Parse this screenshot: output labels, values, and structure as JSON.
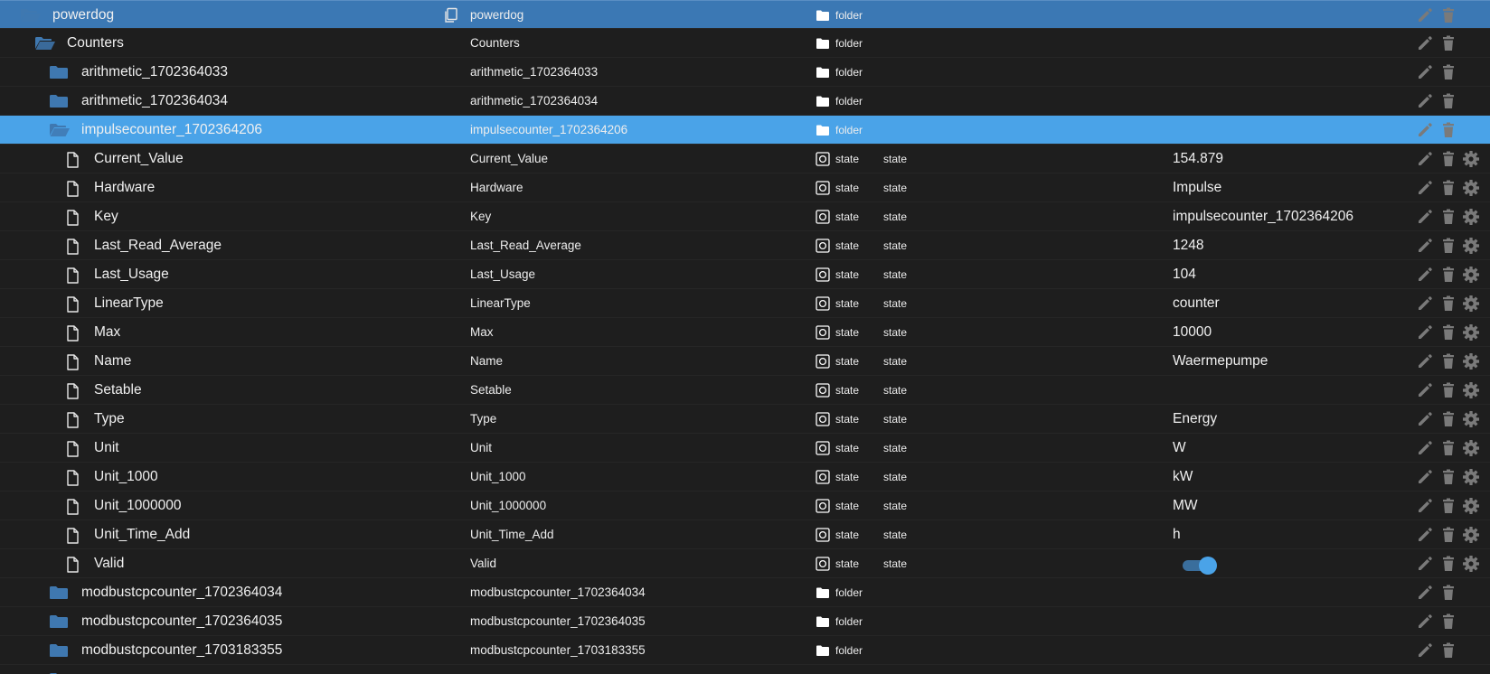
{
  "colors": {
    "background": "#1e1e1e",
    "root_row": "#3b78b4",
    "selected_row": "#4aa3e8",
    "folder_icon": "#3f78b0",
    "action_icon": "#7a7a7a",
    "toggle_on": "#4aa3e8"
  },
  "rows": [
    {
      "name": "powerdog",
      "alias": "powerdog",
      "type": "folder",
      "role": "",
      "value": "",
      "kind": "folder-open",
      "level": 0,
      "root": true,
      "alias_icon": "copy-icon"
    },
    {
      "name": "Counters",
      "alias": "Counters",
      "type": "folder",
      "role": "",
      "value": "",
      "kind": "folder-open",
      "level": 1
    },
    {
      "name": "arithmetic_1702364033",
      "alias": "arithmetic_1702364033",
      "type": "folder",
      "role": "",
      "value": "",
      "kind": "folder",
      "level": 2
    },
    {
      "name": "arithmetic_1702364034",
      "alias": "arithmetic_1702364034",
      "type": "folder",
      "role": "",
      "value": "",
      "kind": "folder",
      "level": 2
    },
    {
      "name": "impulsecounter_1702364206",
      "alias": "impulsecounter_1702364206",
      "type": "folder",
      "role": "",
      "value": "",
      "kind": "folder-open",
      "level": 2,
      "selected": true
    },
    {
      "name": "Current_Value",
      "alias": "Current_Value",
      "type": "state",
      "role": "state",
      "value": "154.879",
      "kind": "file",
      "level": 3
    },
    {
      "name": "Hardware",
      "alias": "Hardware",
      "type": "state",
      "role": "state",
      "value": "Impulse",
      "kind": "file",
      "level": 3
    },
    {
      "name": "Key",
      "alias": "Key",
      "type": "state",
      "role": "state",
      "value": "impulsecounter_1702364206",
      "kind": "file",
      "level": 3
    },
    {
      "name": "Last_Read_Average",
      "alias": "Last_Read_Average",
      "type": "state",
      "role": "state",
      "value": "1248",
      "kind": "file",
      "level": 3
    },
    {
      "name": "Last_Usage",
      "alias": "Last_Usage",
      "type": "state",
      "role": "state",
      "value": "104",
      "kind": "file",
      "level": 3
    },
    {
      "name": "LinearType",
      "alias": "LinearType",
      "type": "state",
      "role": "state",
      "value": "counter",
      "kind": "file",
      "level": 3
    },
    {
      "name": "Max",
      "alias": "Max",
      "type": "state",
      "role": "state",
      "value": "10000",
      "kind": "file",
      "level": 3
    },
    {
      "name": "Name",
      "alias": "Name",
      "type": "state",
      "role": "state",
      "value": "Waermepumpe",
      "kind": "file",
      "level": 3
    },
    {
      "name": "Setable",
      "alias": "Setable",
      "type": "state",
      "role": "state",
      "value": "",
      "kind": "file",
      "level": 3
    },
    {
      "name": "Type",
      "alias": "Type",
      "type": "state",
      "role": "state",
      "value": "Energy",
      "kind": "file",
      "level": 3
    },
    {
      "name": "Unit",
      "alias": "Unit",
      "type": "state",
      "role": "state",
      "value": "W",
      "kind": "file",
      "level": 3
    },
    {
      "name": "Unit_1000",
      "alias": "Unit_1000",
      "type": "state",
      "role": "state",
      "value": "kW",
      "kind": "file",
      "level": 3
    },
    {
      "name": "Unit_1000000",
      "alias": "Unit_1000000",
      "type": "state",
      "role": "state",
      "value": "MW",
      "kind": "file",
      "level": 3
    },
    {
      "name": "Unit_Time_Add",
      "alias": "Unit_Time_Add",
      "type": "state",
      "role": "state",
      "value": "h",
      "kind": "file",
      "level": 3
    },
    {
      "name": "Valid",
      "alias": "Valid",
      "type": "state",
      "role": "state",
      "value": "",
      "kind": "file",
      "level": 3,
      "toggle_on": true
    },
    {
      "name": "modbustcpcounter_1702364034",
      "alias": "modbustcpcounter_1702364034",
      "type": "folder",
      "role": "",
      "value": "",
      "kind": "folder",
      "level": 2
    },
    {
      "name": "modbustcpcounter_1702364035",
      "alias": "modbustcpcounter_1702364035",
      "type": "folder",
      "role": "",
      "value": "",
      "kind": "folder",
      "level": 2
    },
    {
      "name": "modbustcpcounter_1703183355",
      "alias": "modbustcpcounter_1703183355",
      "type": "folder",
      "role": "",
      "value": "",
      "kind": "folder",
      "level": 2
    },
    {
      "name": "",
      "alias": "",
      "type": "",
      "role": "",
      "value": "",
      "kind": "folder",
      "level": 2,
      "partial": true
    }
  ]
}
